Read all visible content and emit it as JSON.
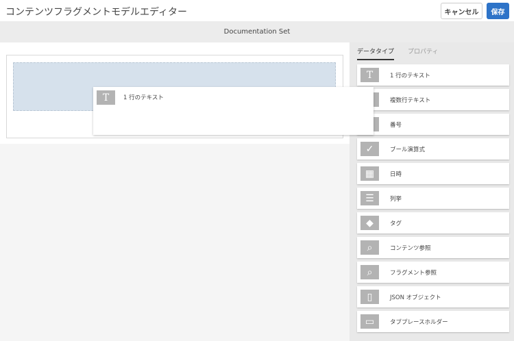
{
  "header": {
    "title": "コンテンツフラグメントモデルエディター",
    "cancel_label": "キャンセル",
    "save_label": "保存",
    "save_color": "#2d73c8"
  },
  "model_title": "Documentation Set",
  "tabs": [
    {
      "label": "データタイプ",
      "active": true
    },
    {
      "label": "プロパティ",
      "active": false
    }
  ],
  "data_types": [
    {
      "label": "1 行のテキスト",
      "icon": "text-icon"
    },
    {
      "label": "複数行テキスト",
      "icon": "multiline-text-icon"
    },
    {
      "label": "番号",
      "icon": "number-icon"
    },
    {
      "label": "ブール演算式",
      "icon": "checkbox-icon"
    },
    {
      "label": "日時",
      "icon": "calendar-icon"
    },
    {
      "label": "列挙",
      "icon": "list-icon"
    },
    {
      "label": "タグ",
      "icon": "tag-icon"
    },
    {
      "label": "コンテンツ参照",
      "icon": "folder-search-icon"
    },
    {
      "label": "フラグメント参照",
      "icon": "folder-search-icon"
    },
    {
      "label": "JSON オブジェクト",
      "icon": "json-file-icon"
    },
    {
      "label": "タブプレースホルダー",
      "icon": "tab-icon"
    }
  ],
  "dragging": {
    "label": "1 行のテキスト",
    "icon": "text-icon"
  }
}
